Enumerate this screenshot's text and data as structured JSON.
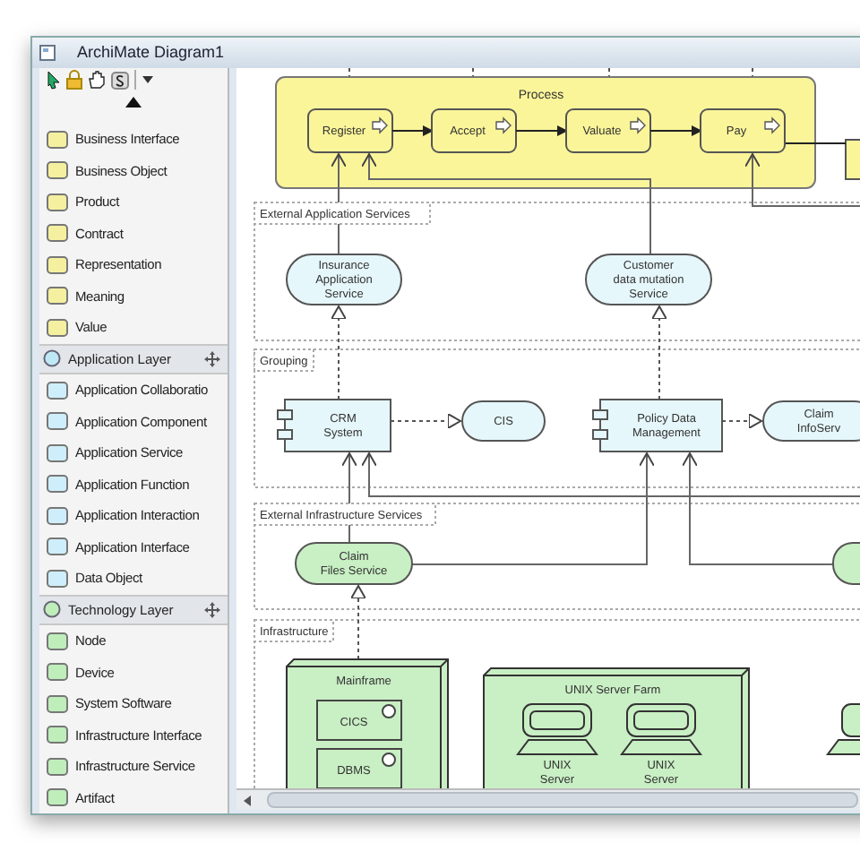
{
  "window": {
    "title": "ArchiMate Diagram1"
  },
  "palette": {
    "items": [
      "Business Interface",
      "Business Object",
      "Product",
      "Contract",
      "Representation",
      "Meaning",
      "Value"
    ],
    "sections": [
      {
        "title": "Application Layer",
        "items": [
          "Application Collaboratio",
          "Application Component",
          "Application Service",
          "Application Function",
          "Application Interaction",
          "Application Interface",
          "Data Object"
        ]
      },
      {
        "title": "Technology Layer",
        "items": [
          "Node",
          "Device",
          "System Software",
          "Infrastructure Interface",
          "Infrastructure Service",
          "Artifact"
        ]
      }
    ]
  },
  "diagram": {
    "process": {
      "label": "Process",
      "steps": [
        "Register",
        "Accept",
        "Valuate",
        "Pay"
      ]
    },
    "layers": [
      "External Application Services",
      "Grouping",
      "External Infrastructure Services",
      "Infrastructure"
    ],
    "elements": [
      {
        "kind": "app-service",
        "lines": [
          "Insurance",
          "Application",
          "Service"
        ]
      },
      {
        "kind": "app-service",
        "lines": [
          "Customer",
          "data mutation",
          "Service"
        ]
      },
      {
        "kind": "component",
        "lines": [
          "CRM",
          "System"
        ]
      },
      {
        "kind": "app-service",
        "lines": [
          "CIS"
        ]
      },
      {
        "kind": "component",
        "lines": [
          "Policy Data",
          "Management"
        ]
      },
      {
        "kind": "app-service",
        "lines": [
          "Claim",
          "InfoServ"
        ]
      },
      {
        "kind": "infra-service",
        "lines": [
          "Claim",
          "Files Service"
        ]
      },
      {
        "kind": "node",
        "lines": [
          "Mainframe"
        ],
        "children": [
          {
            "kind": "system-software",
            "lines": [
              "CICS"
            ]
          },
          {
            "kind": "system-software",
            "lines": [
              "DBMS"
            ]
          }
        ]
      },
      {
        "kind": "node",
        "lines": [
          "UNIX Server Farm"
        ],
        "children": [
          {
            "kind": "device",
            "lines": [
              "UNIX",
              "Server"
            ]
          },
          {
            "kind": "device",
            "lines": [
              "UNIX",
              "Server"
            ]
          }
        ]
      }
    ]
  }
}
